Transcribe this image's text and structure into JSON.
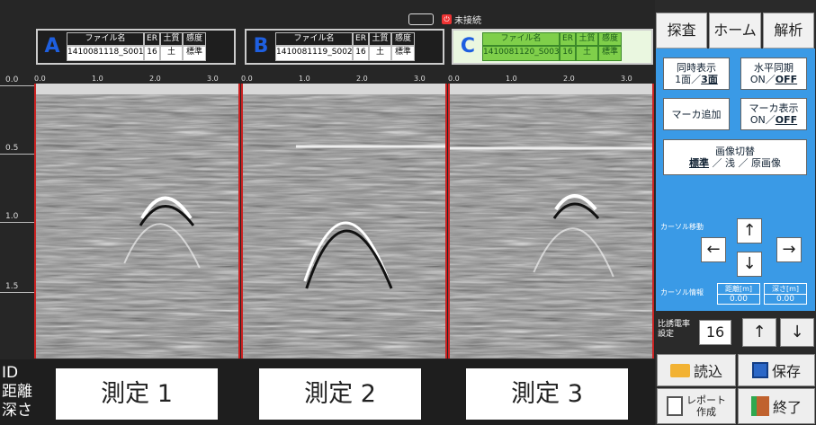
{
  "status": {
    "connection_text": "未接続"
  },
  "files": [
    {
      "letter": "A",
      "header_name": "ファイル名",
      "header_er": "ER",
      "header_soil": "土質",
      "header_sens": "感度",
      "name": "1410081118_S001",
      "er": "16",
      "soil": "土",
      "sens": "標準",
      "color": "#1e5fe0"
    },
    {
      "letter": "B",
      "header_name": "ファイル名",
      "header_er": "ER",
      "header_soil": "土質",
      "header_sens": "感度",
      "name": "1410081119_S002",
      "er": "16",
      "soil": "土",
      "sens": "標準",
      "color": "#1e5fe0"
    },
    {
      "letter": "C",
      "header_name": "ファイル名",
      "header_er": "ER",
      "header_soil": "土質",
      "header_sens": "感度",
      "name": "1410081120_S003",
      "er": "16",
      "soil": "土",
      "sens": "標準",
      "color": "#1e5fe0"
    }
  ],
  "depth_ticks": [
    "0.0",
    "0.5",
    "1.0",
    "1.5"
  ],
  "x_ticks": [
    "0.0",
    "1.0",
    "2.0",
    "3.0"
  ],
  "bottom": {
    "labels": [
      "ID",
      "距離",
      "深さ"
    ],
    "measurements": [
      "測定 1",
      "測定 2",
      "測定 3"
    ]
  },
  "tabs": [
    "探査",
    "ホーム",
    "解析"
  ],
  "controls": {
    "sync_display_line1": "同時表示",
    "sync_display_line2a": "1面／",
    "sync_display_line2b": "3面",
    "hsync_line1": "水平同期",
    "hsync_line2a": "ON／",
    "hsync_line2b": "OFF",
    "add_marker": "マーカ追加",
    "marker_display_line1": "マーカ表示",
    "marker_display_line2a": "ON／",
    "marker_display_line2b": "OFF",
    "image_switch_line1": "画像切替",
    "image_switch_line2a": "標準",
    "image_switch_line2b": "／ 浅 ／ 原画像",
    "cursor_move": "カーソル移動",
    "cursor_info": "カーソル情報",
    "distance_header": "距離[m]",
    "depth_header": "深さ[m]",
    "distance_value": "0.00",
    "depth_value": "0.00",
    "arrow_up": "↑",
    "arrow_down": "↓",
    "arrow_left": "←",
    "arrow_right": "→"
  },
  "permittivity": {
    "label_line1": "比誘電率",
    "label_line2": "設定",
    "value": "16",
    "up": "↑",
    "down": "↓"
  },
  "actions": {
    "load": "読込",
    "save": "保存",
    "report_line1": "レポート",
    "report_line2": "作成",
    "exit": "終了"
  }
}
